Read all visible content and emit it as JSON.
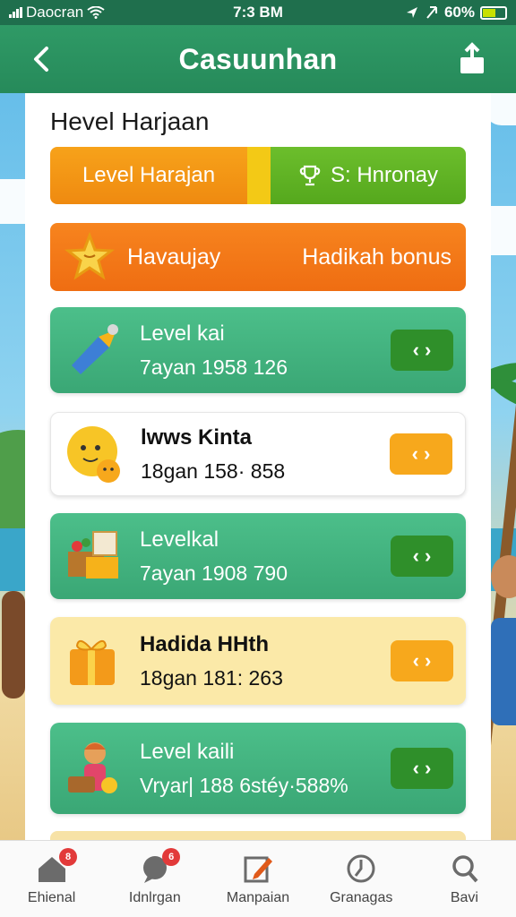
{
  "status_bar": {
    "carrier": "Daocran",
    "time": "7:3 BM",
    "battery": "60%",
    "battery_level": 0.6
  },
  "header": {
    "title": "Casuunhan",
    "back_icon": "chevron-left-icon",
    "share_icon": "share-icon"
  },
  "panel": {
    "title": "Hevel Harjaan",
    "tabs": [
      {
        "label": "Level Harajan"
      },
      {
        "label": "S: Hnronay",
        "icon": "trophy-icon"
      }
    ],
    "bonus": {
      "left_label": "Havaujay",
      "right_label": "Hadikah bonus",
      "icon": "star-icon"
    }
  },
  "cards": [
    {
      "name": "Level kai",
      "meta": "7ayan 1958 126",
      "style": "green",
      "icon": "megaphone-icon",
      "button": "‹ ›"
    },
    {
      "name": "lwws Kinta",
      "meta": "18gan 158· 858",
      "style": "white",
      "icon": "emoji-icon",
      "button": "‹ ›"
    },
    {
      "name": "Levelkal",
      "meta": "7ayan 1908 790",
      "style": "green",
      "icon": "gift-box-icon",
      "button": "‹ ›"
    },
    {
      "name": "Hadida HHth",
      "meta": "18gan 181: 263",
      "style": "yellow",
      "icon": "present-icon",
      "button": "‹ ›"
    },
    {
      "name": "Level kaili",
      "meta": "Vryar| 188 6stéy·588%",
      "style": "green",
      "icon": "person-basket-icon",
      "button": "‹ ›"
    }
  ],
  "bottom_nav": [
    {
      "label": "Ehienal",
      "icon": "home-icon",
      "badge": "8"
    },
    {
      "label": "Idnlrgan",
      "icon": "chat-icon",
      "badge": "6"
    },
    {
      "label": "Manpaian",
      "icon": "edit-icon"
    },
    {
      "label": "Granagas",
      "icon": "clock-icon"
    },
    {
      "label": "Bavi",
      "icon": "profile-icon"
    }
  ],
  "colors": {
    "header": "#268a5a",
    "orange": "#ef8a10",
    "green_tab": "#55a81d",
    "card_green": "#3aa775",
    "card_yellow": "#fbe9a8"
  }
}
